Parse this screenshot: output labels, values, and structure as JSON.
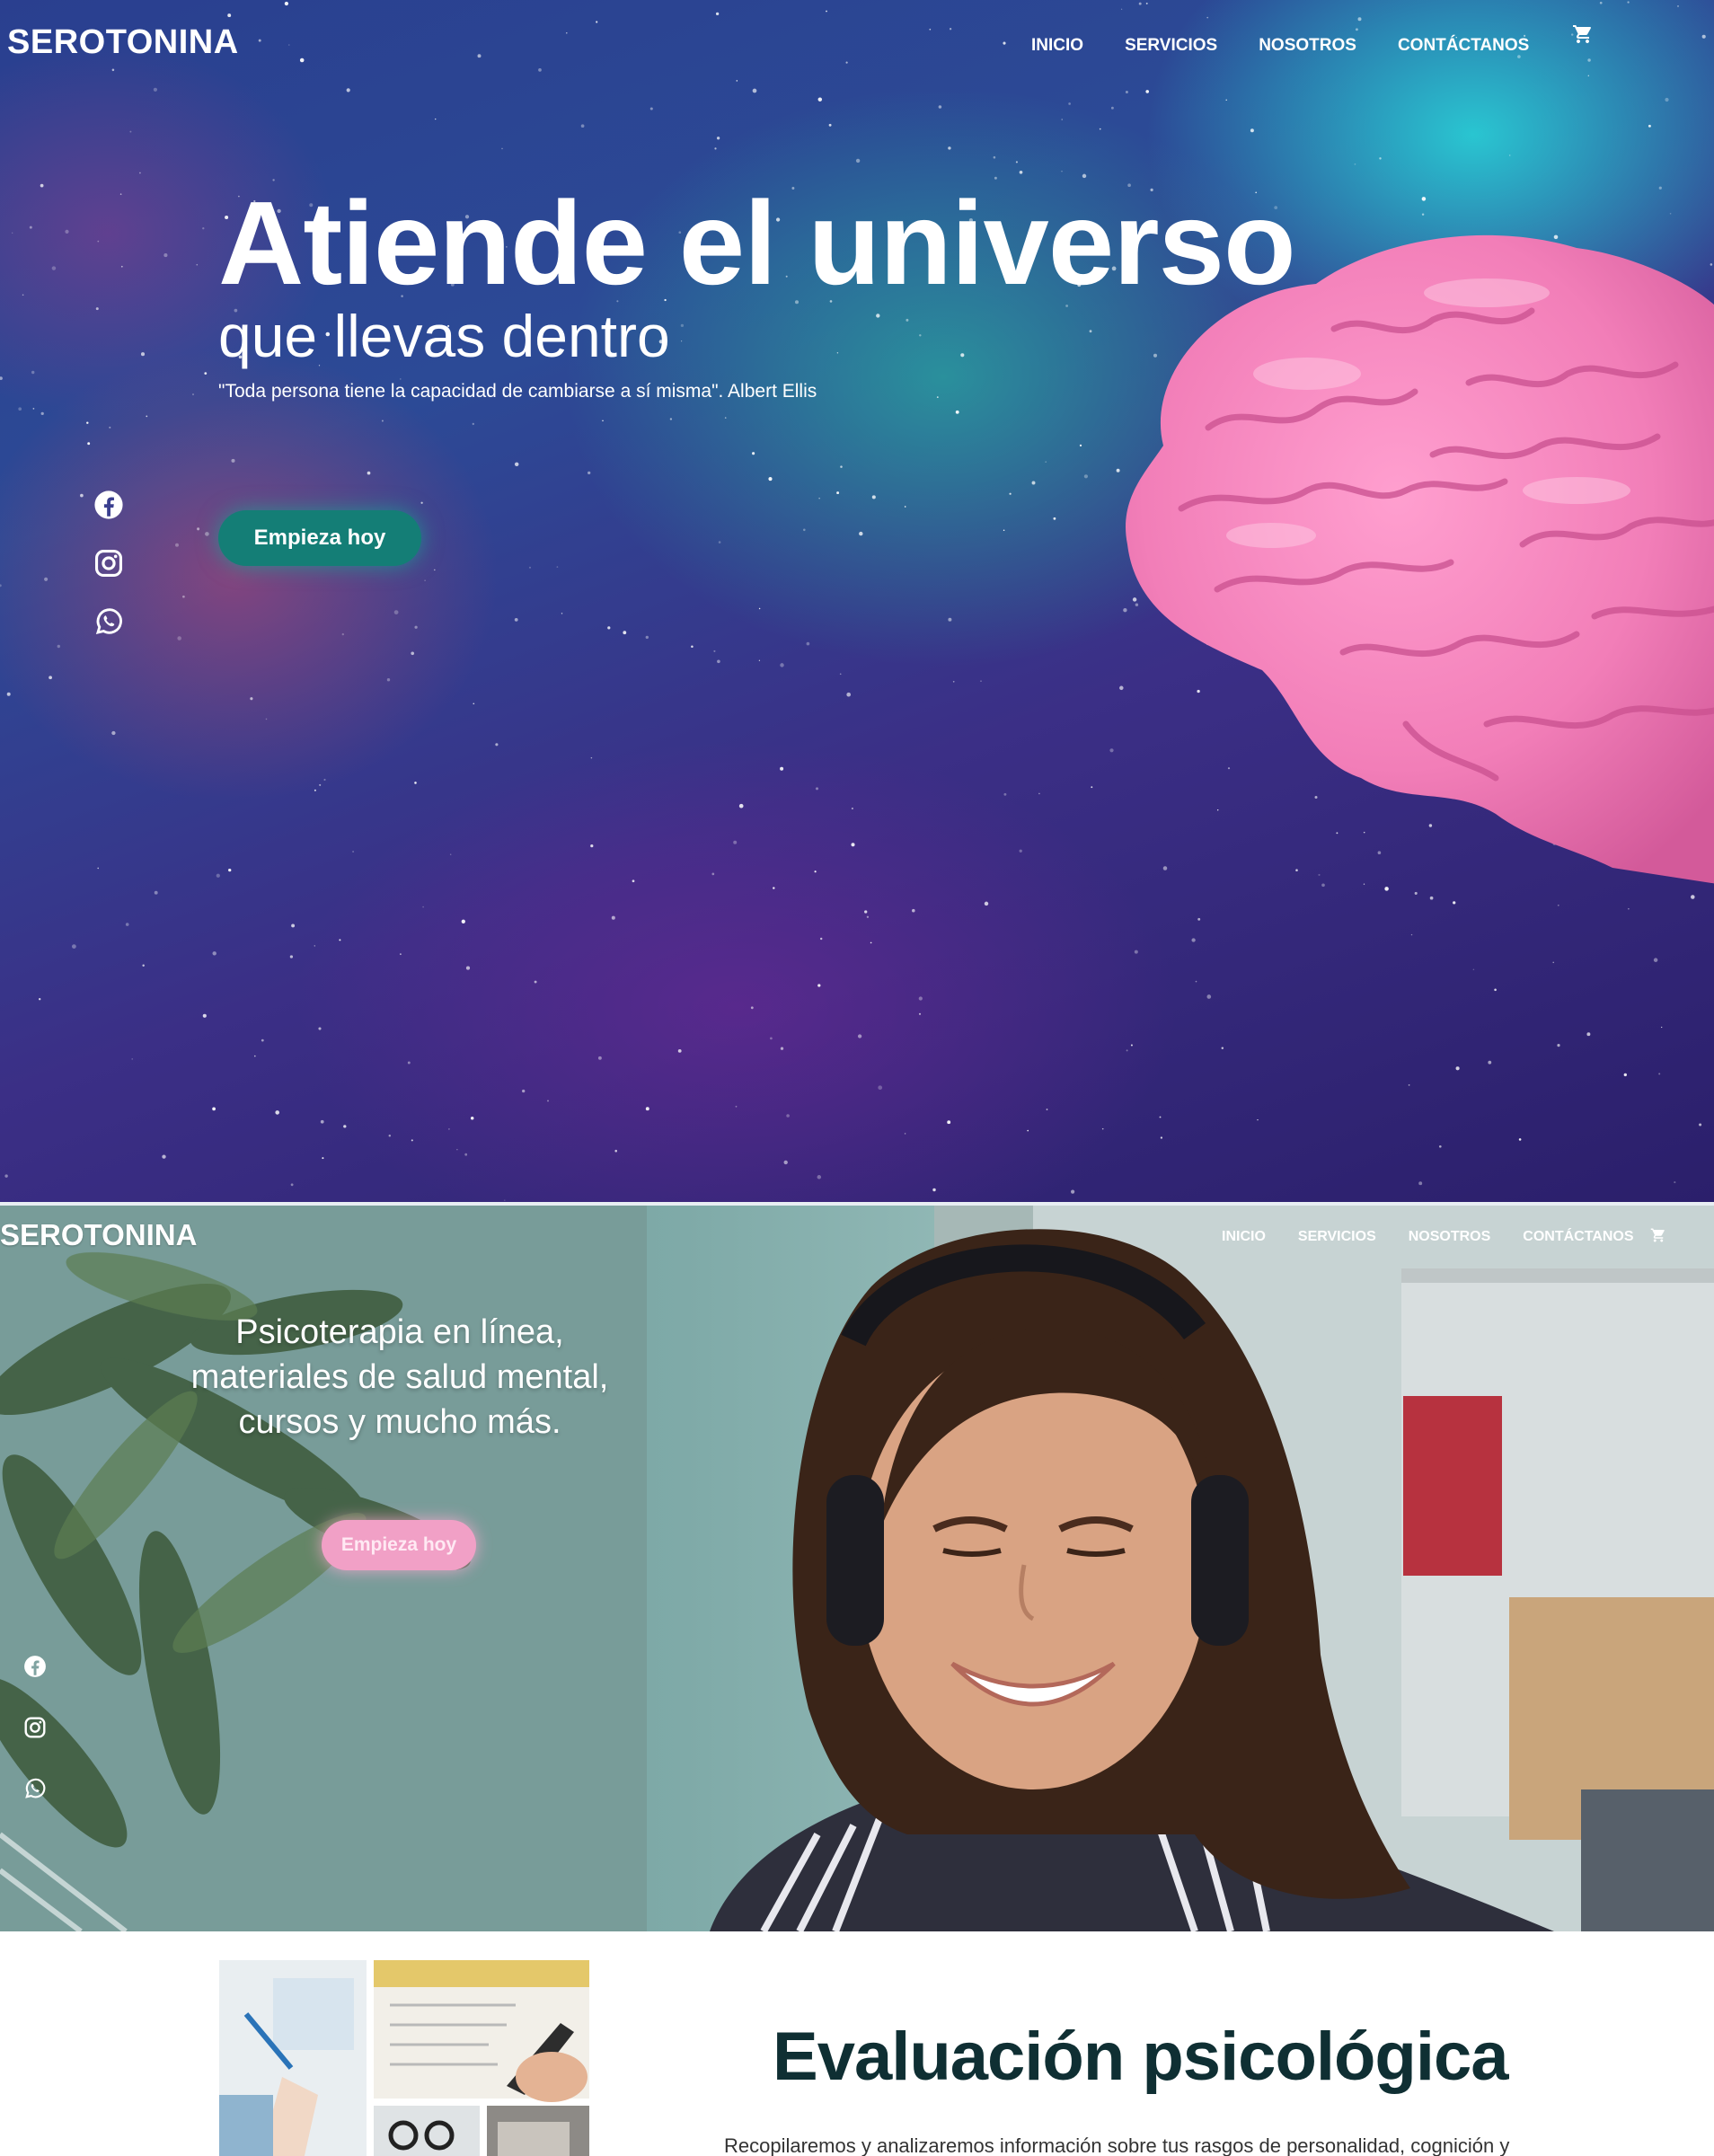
{
  "hero1": {
    "brand": "SEROTONINA",
    "nav": [
      "INICIO",
      "SERVICIOS",
      "NOSOTROS",
      "CONTÁCTANOS"
    ],
    "title": "Atiende el universo",
    "subtitle": "que llevas dentro",
    "quote": "\"Toda persona tiene la capacidad de cambiarse a sí misma\". Albert Ellis",
    "cta": "Empieza hoy",
    "social_icons": [
      "facebook-icon",
      "instagram-icon",
      "whatsapp-icon"
    ]
  },
  "hero2": {
    "brand": "SEROTONINA",
    "nav": [
      "INICIO",
      "SERVICIOS",
      "NOSOTROS",
      "CONTÁCTANOS"
    ],
    "tagline": "Psicoterapia en línea, materiales de salud mental, cursos y mucho más.",
    "cta": "Empieza hoy",
    "social_icons": [
      "facebook-icon",
      "instagram-icon",
      "whatsapp-icon"
    ]
  },
  "service": {
    "title": "Evaluación psicológica",
    "text": "Recopilaremos y analizaremos información sobre tus rasgos de personalidad, cognición y"
  },
  "colors": {
    "hero1_cta": "#147e76",
    "hero2_cta": "#f1a0c6",
    "service_title": "#0f2f33"
  }
}
